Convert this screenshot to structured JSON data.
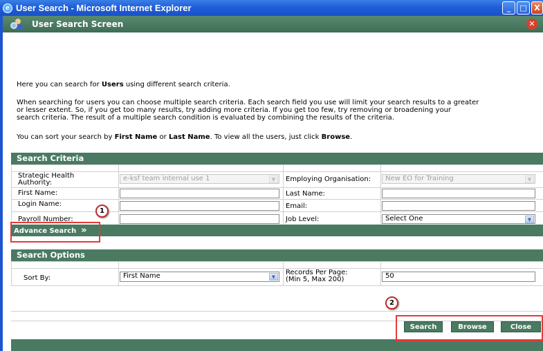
{
  "window": {
    "title": "User Search - Microsoft Internet Explorer",
    "min": "_",
    "max": "□",
    "close": "X"
  },
  "screen": {
    "title": "User Search Screen",
    "close": "✕"
  },
  "intro": {
    "line1_pre": "Here you can search for ",
    "line1_bold": "Users",
    "line1_post": " using different search criteria.",
    "para2_l1": "When searching for users you can choose multiple search criteria. Each search field you use will limit your search results to a greater",
    "para2_l2": "or lesser extent. So, if you get too many results, try adding more criteria. If you get too few, try removing or broadening your",
    "para2_l3": "search criteria. The result of a multiple search condition is evaluated by combining the results of the criteria.",
    "sort_pre": "You can sort your search by ",
    "sort_b1": "First Name",
    "sort_mid": " or ",
    "sort_b2": "Last Name",
    "sort_mid2": ". To view all the users, just click ",
    "sort_b3": "Browse",
    "sort_end": "."
  },
  "criteria": {
    "header": "Search Criteria",
    "sha_label_1": "Strategic Health",
    "sha_label_2": "Authority:",
    "sha_value": "e-ksf team internal use 1",
    "eo_label": "Employing Organisation:",
    "eo_value": "New EO for Training",
    "first_name_label": "First Name:",
    "first_name_value": "",
    "last_name_label": "Last Name:",
    "last_name_value": "",
    "login_label": "Login Name:",
    "login_value": "",
    "email_label": "Email:",
    "email_value": "",
    "payroll_label": "Payroll Number:",
    "payroll_value": "",
    "job_level_label": "Job Level:",
    "job_level_value": "Select One",
    "advance_search": "Advance Search",
    "advance_arrows": "»"
  },
  "options": {
    "header": "Search Options",
    "sort_label": "Sort By:",
    "sort_value": "First Name",
    "records_label_1": "Records Per Page:",
    "records_label_2": "(Min 5, Max 200)",
    "records_value": "50"
  },
  "buttons": {
    "search": "Search",
    "browse": "Browse",
    "close": "Close"
  },
  "annotations": {
    "one": "1",
    "two": "2"
  },
  "colors": {
    "section_green": "#4a7a61",
    "annotation_red": "#e43a3a",
    "ie_blue": "#1f5fd6"
  }
}
